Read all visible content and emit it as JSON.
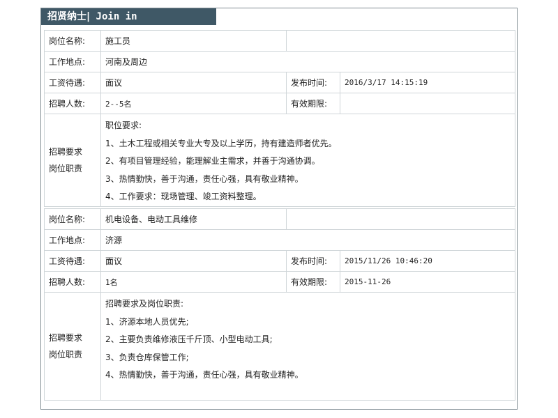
{
  "header": {
    "title_zh": "招贤纳士|",
    "title_en": " Join in"
  },
  "labels": {
    "position": "岗位名称:",
    "location": "工作地点:",
    "salary": "工资待遇:",
    "headcount": "招聘人数:",
    "published": "发布时间:",
    "valid_until": "有效期限:",
    "requirements_1": "招聘要求",
    "requirements_2": "岗位职责"
  },
  "jobs": [
    {
      "position": "施工员",
      "location": "河南及周边",
      "salary": "面议",
      "published": "2016/3/17 14:15:19",
      "headcount": "2--5名",
      "valid_until": "",
      "requirements": [
        "职位要求:",
        "1、土木工程或相关专业大专及以上学历，持有建造师者优先。",
        "2、有项目管理经验，能理解业主需求，并善于沟通协调。",
        "3、热情勤快，善于沟通，责任心强，具有敬业精神。",
        "4、工作要求：现场管理、竣工资料整理。"
      ]
    },
    {
      "position": "机电设备、电动工具维修",
      "location": "济源",
      "salary": "面议",
      "published": "2015/11/26 10:46:20",
      "headcount": "1名",
      "valid_until": "2015-11-26",
      "requirements": [
        "招聘要求及岗位职责:",
        "1、济源本地人员优先;",
        "2、主要负责维修液压千斤顶、小型电动工具;",
        "3、负责仓库保管工作;",
        "4、热情勤快，善于沟通，责任心强，具有敬业精神。"
      ]
    }
  ]
}
